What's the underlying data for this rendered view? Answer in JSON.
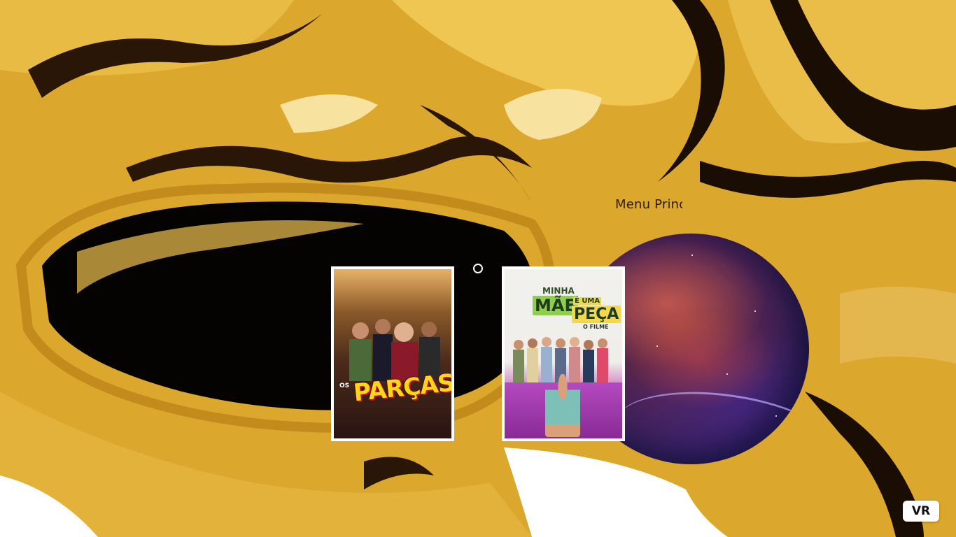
{
  "scene": {
    "menu_label": "Menu Principal",
    "vr_button": "VR"
  },
  "posters": [
    {
      "title": "PARÇAS",
      "prefix": "OS"
    },
    {
      "title_top": "MINHA",
      "title_mae": "MÃE",
      "title_e": "É UMA",
      "title_peca": "PEÇA",
      "title_filme": "O FILME"
    }
  ],
  "colors": {
    "background_gold": "#d9a42a",
    "poster_border": "#ffffff",
    "vr_button_bg": "#ffffff"
  },
  "icons": {
    "gaze-cursor": "ring",
    "planet-sphere": "planet"
  }
}
